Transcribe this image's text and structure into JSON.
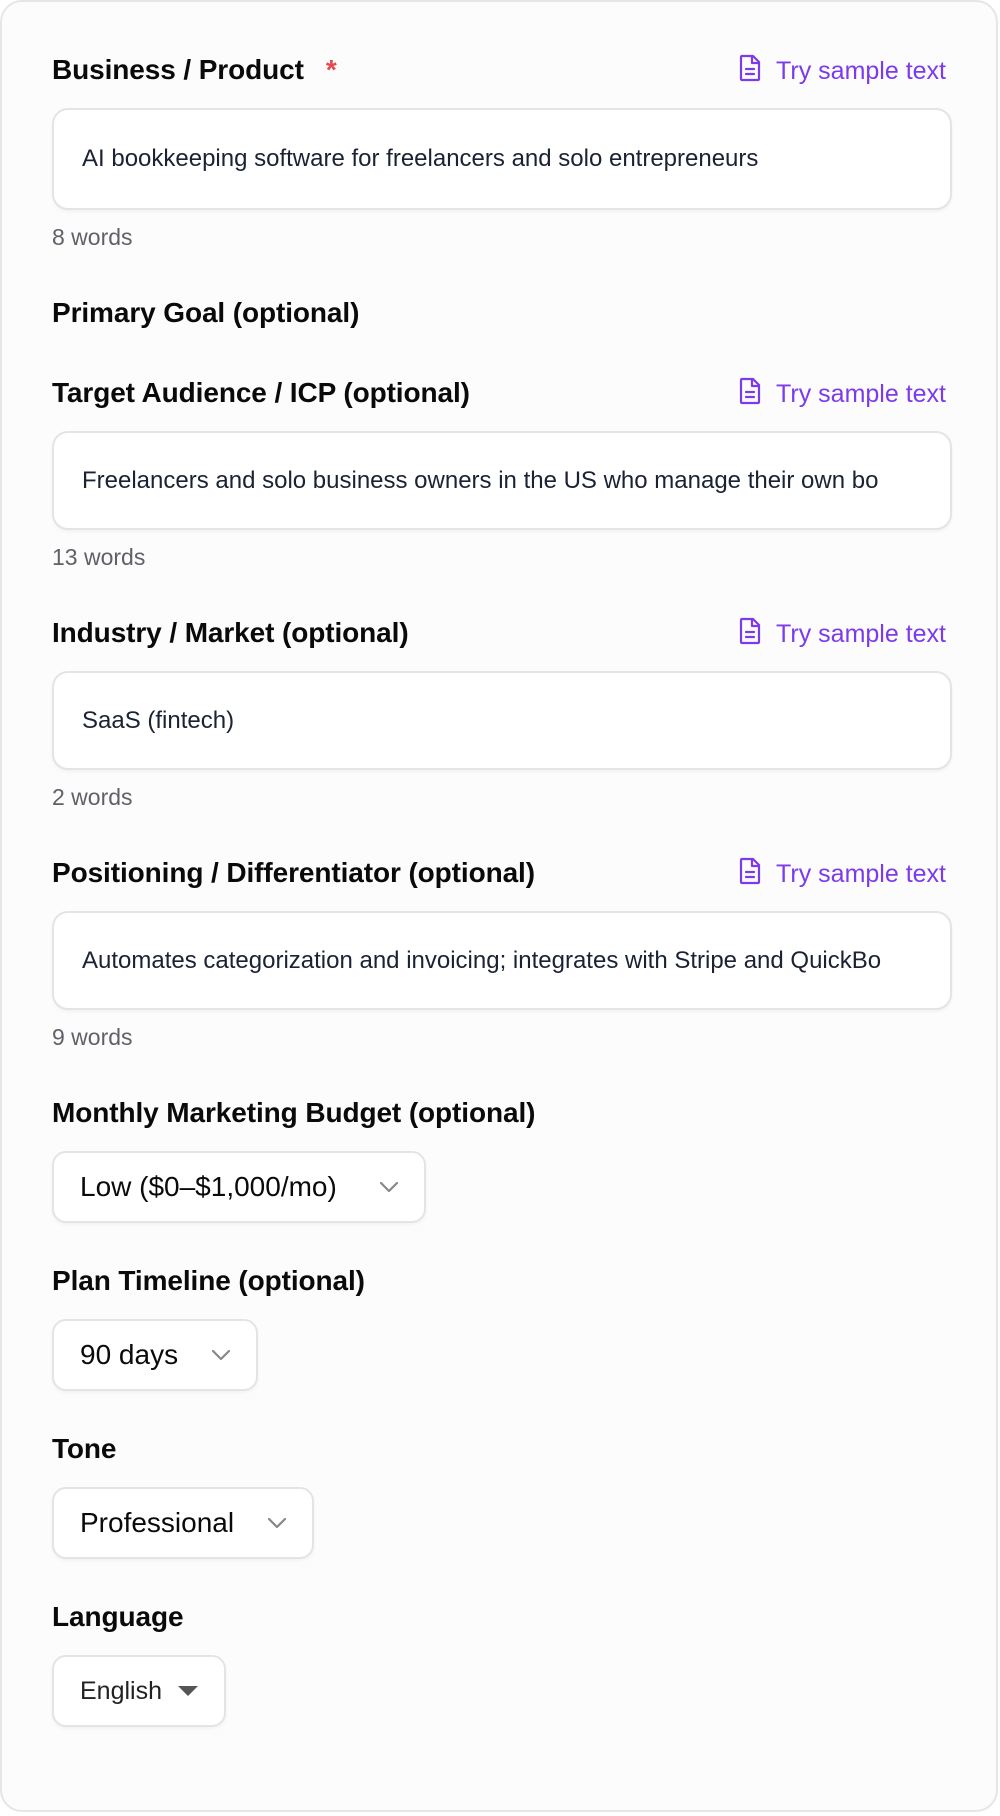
{
  "business": {
    "label": "Business / Product",
    "required_mark": "*",
    "sample_label": "Try sample text",
    "value": "AI bookkeeping software for freelancers and solo entrepreneurs",
    "word_count": "8 words"
  },
  "primary_goal": {
    "label": "Primary Goal (optional)"
  },
  "audience": {
    "label": "Target Audience / ICP (optional)",
    "sample_label": "Try sample text",
    "value": "Freelancers and solo business owners in the US who manage their own bo",
    "word_count": "13 words"
  },
  "industry": {
    "label": "Industry / Market (optional)",
    "sample_label": "Try sample text",
    "value": "SaaS (fintech)",
    "word_count": "2 words"
  },
  "positioning": {
    "label": "Positioning / Differentiator (optional)",
    "sample_label": "Try sample text",
    "value": "Automates categorization and invoicing; integrates with Stripe and QuickBo",
    "word_count": "9 words"
  },
  "budget": {
    "label": "Monthly Marketing Budget (optional)",
    "selected": "Low ($0–$1,000/mo)"
  },
  "timeline": {
    "label": "Plan Timeline (optional)",
    "selected": "90 days"
  },
  "tone": {
    "label": "Tone",
    "selected": "Professional"
  },
  "language": {
    "label": "Language",
    "selected": "English"
  },
  "colors": {
    "accent": "#7c3aed",
    "required": "#e5484d",
    "border": "#e3e4e8"
  }
}
